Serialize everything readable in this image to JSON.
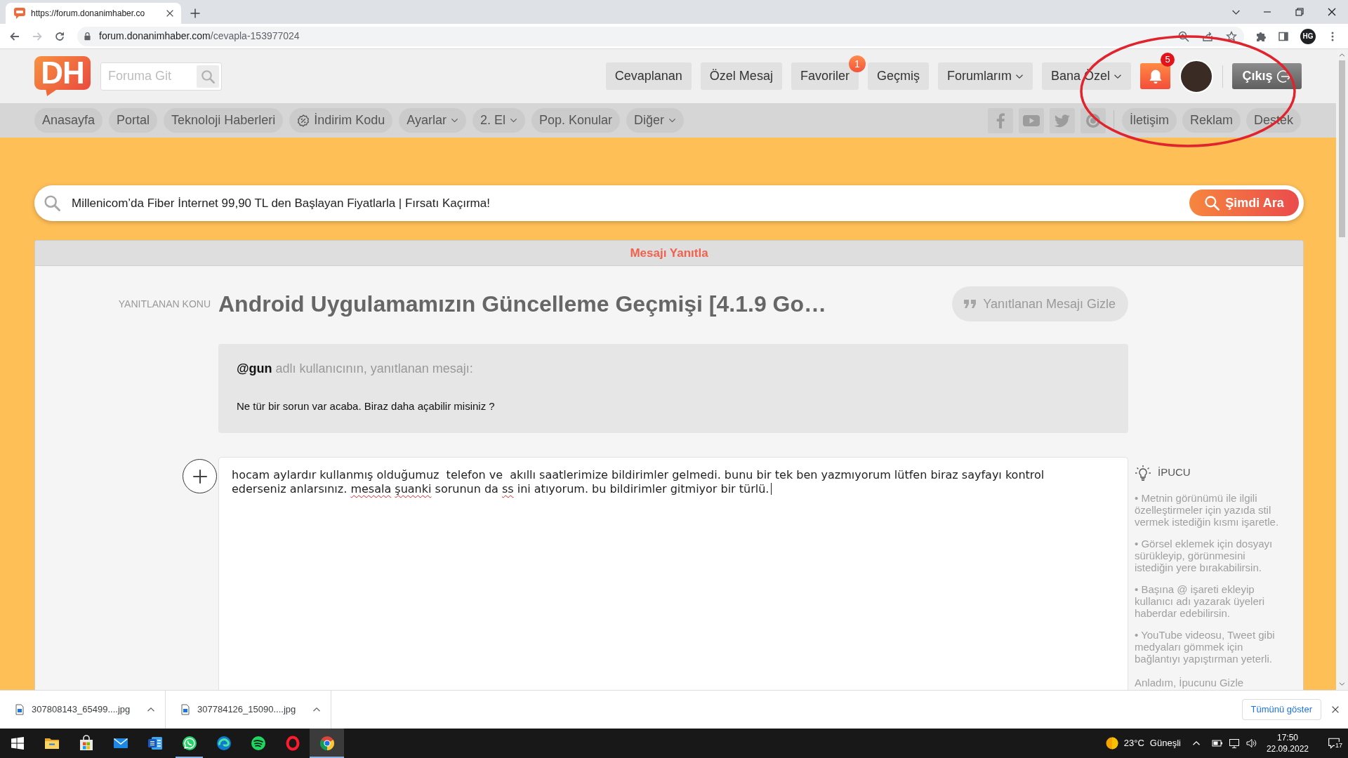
{
  "browser": {
    "tab": {
      "title": "https://forum.donanimhaber.co"
    },
    "forward_disabled": true,
    "url": {
      "host": "forum.donanimhaber.com",
      "path": "/cevapla-153977024"
    },
    "profile": "HG"
  },
  "header": {
    "logo": "DH",
    "search": {
      "placeholder": "Foruma Git"
    },
    "buttons": [
      {
        "label": "Cevaplanan",
        "dropdown": false
      },
      {
        "label": "Özel Mesaj",
        "dropdown": false
      },
      {
        "label": "Favoriler",
        "dropdown": false,
        "badge": "1"
      },
      {
        "label": "Geçmiş",
        "dropdown": false
      },
      {
        "label": "Forumlarım",
        "dropdown": true
      },
      {
        "label": "Bana Özel",
        "dropdown": true
      }
    ],
    "notifications": {
      "badge": "5"
    },
    "logout": "Çıkış"
  },
  "nav": {
    "items": [
      {
        "label": "Anasayfa",
        "kind": "link",
        "dropdown": false
      },
      {
        "label": "Portal",
        "kind": "link",
        "dropdown": false
      },
      {
        "label": "Teknoloji Haberleri",
        "kind": "link",
        "dropdown": false
      },
      {
        "label": "İndirim Kodu",
        "kind": "coupon",
        "dropdown": false
      },
      {
        "label": "Ayarlar",
        "kind": "link",
        "dropdown": true
      },
      {
        "label": "2. El",
        "kind": "link",
        "dropdown": true
      },
      {
        "label": "Pop. Konular",
        "kind": "link",
        "dropdown": false
      },
      {
        "label": "Diğer",
        "kind": "link",
        "dropdown": true
      }
    ],
    "links": [
      "İletişim",
      "Reklam",
      "Destek"
    ]
  },
  "promo_search": {
    "value": "Millenicom’da Fiber İnternet 99,90 TL den Başlayan Fiyatlarla | Fırsatı Kaçırma!",
    "button": "Şimdi Ara"
  },
  "reply": {
    "title": "Mesajı Yanıtla",
    "topic_label": "YANITLANAN KONU",
    "topic": "Android Uygulamamızın Güncelleme Geçmişi [4.1.9 Go…",
    "hide_button": "Yanıtlanan Mesajı Gizle",
    "quote": {
      "user": "@gun",
      "intro": "adlı kullanıcının, yanıtlanan mesajı:",
      "text": "Ne tür bir sorun var acaba. Biraz daha açabilir misiniz ?"
    },
    "editor": {
      "segments": [
        {
          "text": "hocam aylardır kullanmış olduğumuz  telefon ve  akıllı saatlerimize bildirimler gelmedi. bunu bir tek ben yazmıyorum lütfen biraz sayfayı kontrol ederseniz anlarsınız. ",
          "misspelled": false
        },
        {
          "text": "mesala",
          "misspelled": true
        },
        {
          "text": " şuanki",
          "misspelled": true
        },
        {
          "text": " sorunun da ",
          "misspelled": false
        },
        {
          "text": "ss",
          "misspelled": true
        },
        {
          "text": " ini atıyorum. bu bildirimler gitmiyor bir türlü.",
          "misspelled": false
        }
      ]
    },
    "tips": {
      "title": "İPUCU",
      "items": [
        "• Metnin görünümü ile ilgili özelleştirmeler için yazıda stil vermek istediğin kısmı işaretle.",
        "• Görsel eklemek için dosyayı sürükleyip, görünmesini istediğin yere bırakabilirsin.",
        "• Başına @ işareti ekleyip kullanıcı adı yazarak üyeleri haberdar edebilirsin.",
        "• YouTube videosu, Tweet gibi medyaları gömmek için bağlantıyı yapıştırman yeterli."
      ],
      "dismiss": "Anladım, İpucunu Gizle"
    }
  },
  "downloads": {
    "items": [
      {
        "name": "307808143_65499....jpg"
      },
      {
        "name": "307784126_15090....jpg"
      }
    ],
    "show_all": "Tümünü göster"
  },
  "taskbar": {
    "apps": [
      {
        "running": false,
        "selected": false
      },
      {
        "running": false,
        "selected": false
      },
      {
        "running": false,
        "selected": false
      },
      {
        "running": false,
        "selected": false
      },
      {
        "running": true,
        "selected": false
      },
      {
        "running": false,
        "selected": false
      },
      {
        "running": false,
        "selected": false
      },
      {
        "running": false,
        "selected": false
      },
      {
        "running": true,
        "selected": true
      }
    ],
    "weather": {
      "temperature": "23°C",
      "condition": "Güneşli"
    },
    "time": "17:50",
    "date": "22.09.2022",
    "notification_count": "17"
  },
  "annotations": [
    {
      "kind": "ellipse"
    }
  ]
}
